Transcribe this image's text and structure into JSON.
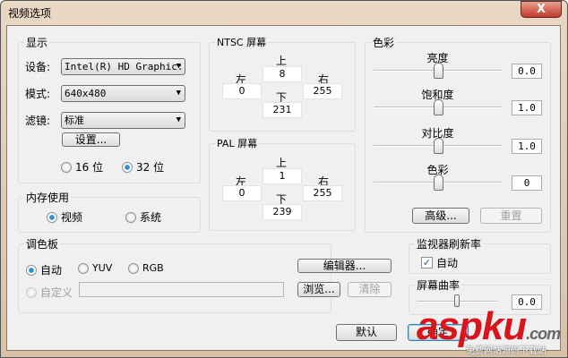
{
  "window": {
    "title": "视频选项",
    "close": "X"
  },
  "display": {
    "label": "显示",
    "device_label": "设备:",
    "device_value": "Intel(R) HD Graphic:",
    "mode_label": "模式:",
    "mode_value": "640x480",
    "filter_label": "滤镜:",
    "filter_value": "标准",
    "settings_button": "设置...",
    "bit16": "16 位",
    "bit32": "32 位",
    "selected_bits": "32"
  },
  "ntsc": {
    "label": "NTSC 屏幕",
    "top_label": "上",
    "top": "8",
    "left_label": "左",
    "left": "0",
    "right_label": "右",
    "right": "255",
    "bottom_label": "下",
    "bottom": "231"
  },
  "pal": {
    "label": "PAL 屏幕",
    "top_label": "上",
    "top": "1",
    "left_label": "左",
    "left": "0",
    "right_label": "右",
    "right": "255",
    "bottom_label": "下",
    "bottom": "239"
  },
  "color": {
    "label": "色彩",
    "sliders": [
      {
        "label": "亮度",
        "value": "0.0",
        "position": 0.5
      },
      {
        "label": "饱和度",
        "value": "1.0",
        "position": 0.5
      },
      {
        "label": "对比度",
        "value": "1.0",
        "position": 0.5
      },
      {
        "label": "色彩",
        "value": "0",
        "position": 0.5
      }
    ],
    "advanced_button": "高级...",
    "reset_button": "重置"
  },
  "memory": {
    "label": "内存使用",
    "video": "视频",
    "system": "系统",
    "selected": "video"
  },
  "palette": {
    "label": "调色板",
    "auto": "自动",
    "yuv": "YUV",
    "rgb": "RGB",
    "custom": "自定义",
    "custom_value": "",
    "editor_button": "编辑器...",
    "browse_button": "浏览...",
    "clear_button": "清除"
  },
  "refresh": {
    "label": "监视器刷新率",
    "auto": "自动",
    "checked": true
  },
  "curvature": {
    "label": "屏幕曲率",
    "value": "0.0",
    "position": 0.5
  },
  "footer": {
    "default_button": "默认",
    "ok_button": "确定"
  },
  "watermark": {
    "brand": "aspku",
    "suffix": ".com",
    "tagline": "免费网站源码下载站"
  }
}
